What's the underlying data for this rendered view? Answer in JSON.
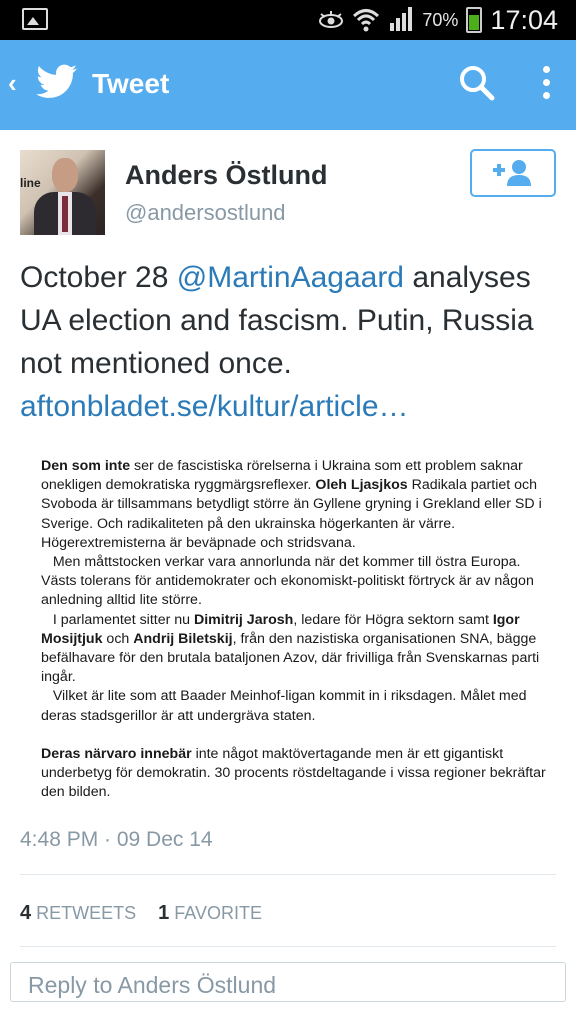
{
  "status_bar": {
    "battery_percent": "70%",
    "time": "17:04",
    "icons": [
      "image-icon",
      "eye-icon",
      "wifi-icon",
      "signal-icon",
      "battery-icon"
    ]
  },
  "app_bar": {
    "title": "Tweet",
    "accent_color": "#55acee",
    "icons": [
      "back-icon",
      "twitter-bird-icon",
      "search-icon",
      "more-vert-icon"
    ]
  },
  "author": {
    "name": "Anders Östlund",
    "handle": "@andersostlund",
    "avatar_sign_text": "line"
  },
  "tweet": {
    "text_prefix": "October 28 ",
    "mention": "@MartinAagaard",
    "text_middle": " analyses UA election and fascism. Putin, Russia not mentioned once.",
    "link": "aftonbladet.se/kultur/article…"
  },
  "article_image": {
    "p1_bold1": "Den som inte",
    "p1_text1": " ser de fascistiska rörelserna i Ukraina som ett problem saknar onekligen demokratiska ryggmärgsreflexer. ",
    "p1_bold2": "Oleh Ljasjkos",
    "p1_text2": " Radikala partiet och Svoboda är tillsammans betydligt större än Gyllene gryning i Grekland eller SD i Sverige. Och radikaliteten på den ukrainska högerkanten är värre. Högerextremisterna är beväpnade och stridsvana.",
    "p2": "Men måttstocken verkar vara annorlunda när det kommer till östra Europa. Västs tolerans för antidemokrater och ekonomiskt-politiskt förtryck är av någon anledning alltid lite större.",
    "p3_text1": "I parlamentet sitter nu ",
    "p3_bold1": "Dimitrij Jarosh",
    "p3_text2": ", ledare för Högra sektorn samt ",
    "p3_bold2": "Igor Mosijtjuk",
    "p3_text3": " och ",
    "p3_bold3": "Andrij Biletskij",
    "p3_text4": ", från den nazistiska organisationen SNA, bägge befälhavare för den brutala bataljonen Azov, där frivilliga från Svenskarnas parti ingår.",
    "p4": "Vilket är lite som att Baader Meinhof-ligan kommit in i riksdagen. Målet med deras stadsgerillor är att undergräva staten.",
    "p5_bold": "Deras närvaro innebär",
    "p5_text": " inte något maktövertagande men är ett gigantiskt underbetyg för demokratin. 30 procents röstdeltagande i vissa regioner bekräftar den bilden."
  },
  "meta": {
    "timestamp": "4:48 PM · 09 Dec 14"
  },
  "stats": {
    "retweets_count": "4",
    "retweets_label": "RETWEETS",
    "favorites_count": "1",
    "favorites_label": "FAVORITE"
  },
  "reply": {
    "placeholder": "Reply to Anders Östlund"
  }
}
